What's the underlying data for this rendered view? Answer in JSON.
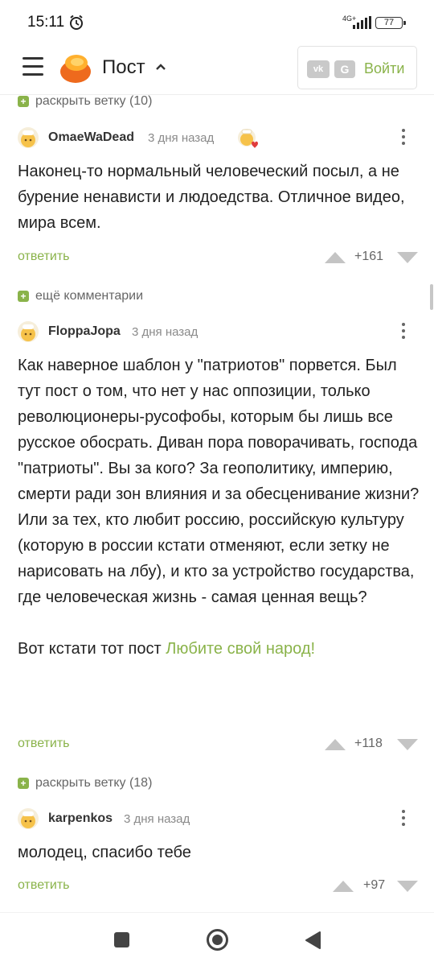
{
  "status_bar": {
    "time": "15:11",
    "network": "4G+",
    "battery": "77",
    "icons": [
      "alarm-icon",
      "signal-icon",
      "battery-icon"
    ]
  },
  "header": {
    "title": "Пост",
    "login_label": "Войти",
    "vk_label": "vk",
    "google_label": "G",
    "icons": [
      "menu-icon",
      "logo-icon",
      "chevron-up-icon",
      "vk-icon",
      "google-icon"
    ],
    "accent_color": "#8ab34a"
  },
  "feed": {
    "expand_top": "раскрыть ветку (10)",
    "more_comments": "ещё комментарии",
    "expand_bottom": "раскрыть ветку (18)",
    "comments": [
      {
        "username": "OmaeWaDead",
        "time": "3 дня назад",
        "text": [
          "Наконец-то нормальный человеческий посыл, а не бурение ненависти и людоедства. Отличное видео, мира всем."
        ],
        "reply": "ответить",
        "rating": "+161"
      },
      {
        "username": "FloppaJopa",
        "time": "3 дня назад",
        "text": [
          "Как наверное шаблон у \"патриотов\" порвется. Был тут пост о том, что нет у нас оппозиции, только революционеры-русофобы, которым бы лишь все русское обосрать. Диван пора поворачивать, господа \"патриоты\". Вы за кого? За геополитику, империю, смерти ради зон влияния и за обесценивание жизни? Или за тех, кто любит россию, российскую культуру (которую в россии кстати отменяют, если зетку не нарисовать на лбу), и кто за устройство государства, где человеческая жизнь - самая ценная вещь?",
          "Вот кстати тот пост "
        ],
        "link": "Любите свой народ!",
        "reply": "ответить",
        "rating": "+118"
      },
      {
        "username": "karpenkos",
        "time": "3 дня назад",
        "text": [
          "молодец, спасибо тебе"
        ],
        "reply": "ответить",
        "rating": "+97"
      }
    ]
  },
  "nav_bar": {
    "icons": [
      "recents-icon",
      "home-icon",
      "back-icon"
    ]
  }
}
